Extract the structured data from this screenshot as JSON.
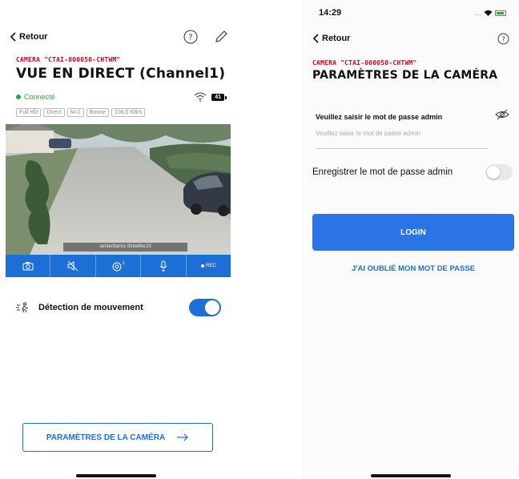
{
  "left_screen": {
    "nav": {
      "back_label": "Retour"
    },
    "camera_id": "CAMERA \"CTAI-000050-CHTWM\"",
    "title": "VUE EN DIRECT (Channel1)",
    "status": {
      "connection": "Connecté",
      "battery_badge": "41"
    },
    "stream_tags": [
      "Full HD",
      "Direct",
      "N=1",
      "Bonne",
      "106.0 KB/s"
    ],
    "video": {
      "caption": "sentenfarms 0Intellhe1S"
    },
    "toolbar": {
      "rec_label": "REC"
    },
    "motion": {
      "label": "Détection de mouvement",
      "enabled": true
    },
    "settings_button": "PARAMÈTRES DE LA CAMÉRA"
  },
  "right_screen": {
    "statusbar": {
      "time": "14:29",
      "signal_dots": "...."
    },
    "nav": {
      "back_label": "Retour"
    },
    "camera_id": "CAMERA \"CTAI-000050-CHTWM\"",
    "title": "PARAMÈTRES DE LA CAMÉRA",
    "password": {
      "label": "Veuillez saisir le mot de passe admin",
      "placeholder": "Veuillez saisir le mot de passe admin"
    },
    "save_password": {
      "label": "Enregistrer le mot de passe admin",
      "enabled": false
    },
    "login_button": "LOGIN",
    "forgot_link": "J'AI OUBLIÉ MON MOT DE PASSE"
  },
  "colors": {
    "accent": "#1b6fd6",
    "brand_red": "#d0021b",
    "connected_green": "#2aa845"
  }
}
